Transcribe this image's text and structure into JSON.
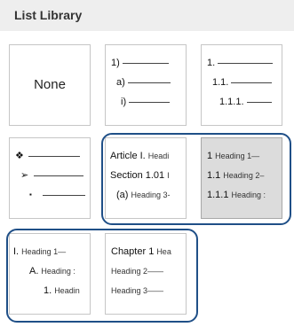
{
  "header": {
    "title": "List Library"
  },
  "tiles": {
    "none": {
      "label": "None"
    },
    "numbered_paren": {
      "l1": "1)",
      "l2": "a)",
      "l3": "i)"
    },
    "numbered_decimal": {
      "l1": "1.",
      "l2": "1.1.",
      "l3": "1.1.1."
    },
    "bullets": {
      "l1": "❖",
      "l2": "➢",
      "l3": "▪"
    },
    "article_section": {
      "l1_num": "Article I.",
      "l1_text": "Headi",
      "l2_num": "Section 1.01",
      "l2_text": "I",
      "l3_num": "(a)",
      "l3_text": "Heading 3-"
    },
    "heading_numbered": {
      "l1_num": "1",
      "l1_text": "Heading 1—",
      "l2_num": "1.1",
      "l2_text": "Heading 2–",
      "l3_num": "1.1.1",
      "l3_text": "Heading :"
    },
    "roman_heading": {
      "l1_num": "I.",
      "l1_text": "Heading 1—",
      "l2_num": "A.",
      "l2_text": "Heading :",
      "l3_num": "1.",
      "l3_text": "Headin"
    },
    "chapter_heading": {
      "l1_num": "Chapter 1",
      "l1_text": "Hea",
      "l2_text": "Heading 2——",
      "l3_text": "Heading 3——"
    }
  },
  "colors": {
    "highlight": "#1f4f87",
    "selected_tile": "#dcdcdc"
  }
}
